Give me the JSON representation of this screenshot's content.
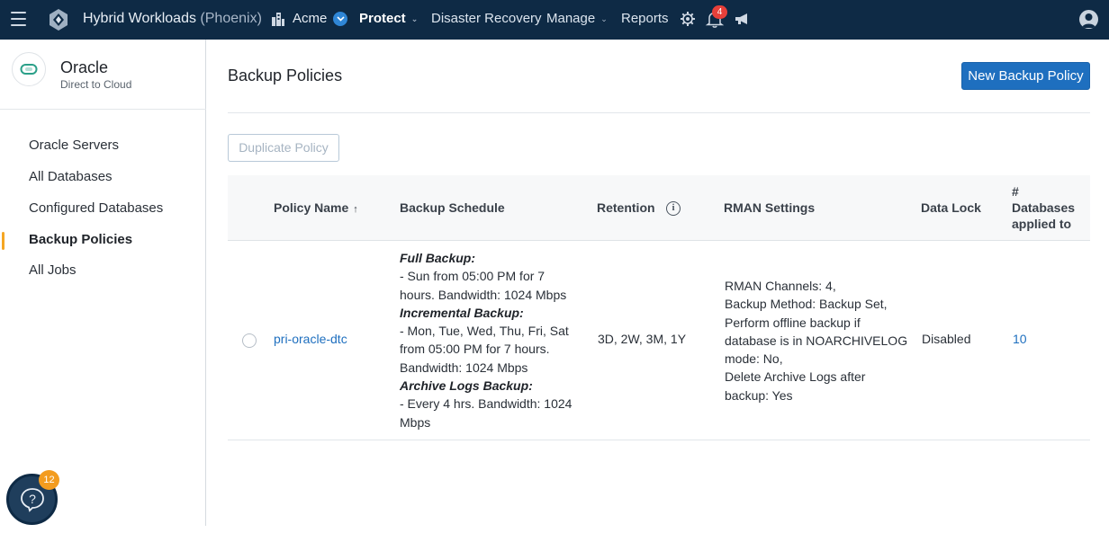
{
  "header": {
    "app_title": "Hybrid Workloads",
    "env": "(Phoenix)",
    "tenant": "Acme",
    "nav": [
      {
        "label": "Protect"
      },
      {
        "label": "Disaster Recovery"
      },
      {
        "label": "Manage"
      },
      {
        "label": "Reports"
      }
    ],
    "notifications_count": "4",
    "icons": [
      "menu-icon",
      "logo-icon",
      "building-icon",
      "chevron-down-icon",
      "gear-icon",
      "bell-icon",
      "megaphone-icon",
      "user-avatar-icon"
    ]
  },
  "sidebar": {
    "app_name": "Oracle",
    "app_subtitle": "Direct to Cloud",
    "items": [
      {
        "label": "Oracle Servers"
      },
      {
        "label": "All Databases"
      },
      {
        "label": "Configured Databases"
      },
      {
        "label": "Backup Policies"
      },
      {
        "label": "All Jobs"
      }
    ],
    "active_item": "Backup Policies",
    "help_badge": "12"
  },
  "main": {
    "title": "Backup Policies",
    "new_button": "New Backup Policy",
    "duplicate_button": "Duplicate Policy",
    "columns": {
      "policy_name": "Policy Name",
      "sort_arrow": "↑",
      "schedule": "Backup Schedule",
      "retention": "Retention",
      "rman": "RMAN Settings",
      "data_lock": "Data Lock",
      "db_hash": "#",
      "db_line1": "Databases",
      "db_line2": "applied to"
    },
    "rows": [
      {
        "policy_name": "pri-oracle-dtc",
        "full_label": "Full Backup:",
        "full_text": "- Sun from 05:00 PM for 7 hours. Bandwidth: 1024 Mbps",
        "incr_label": "Incremental Backup:",
        "incr_text": "- Mon, Tue, Wed, Thu, Fri, Sat from 05:00 PM for 7 hours. Bandwidth: 1024 Mbps",
        "arch_label": "Archive Logs Backup:",
        "arch_text": "- Every 4 hrs. Bandwidth: 1024 Mbps",
        "retention": "3D, 2W, 3M, 1Y",
        "rman_1": "RMAN Channels: 4,",
        "rman_2": "Backup Method: Backup Set,",
        "rman_3": "Perform offline backup if database is in NOARCHIVELOG mode: No,",
        "rman_4": "Delete Archive Logs after backup: Yes",
        "data_lock": "Disabled",
        "databases": "10"
      }
    ]
  },
  "colors": {
    "topbar": "#0e2a45",
    "primary": "#1e6fbf",
    "active_marker": "#f5a623",
    "badge_red": "#e8403a",
    "badge_orange": "#f39c1f"
  }
}
